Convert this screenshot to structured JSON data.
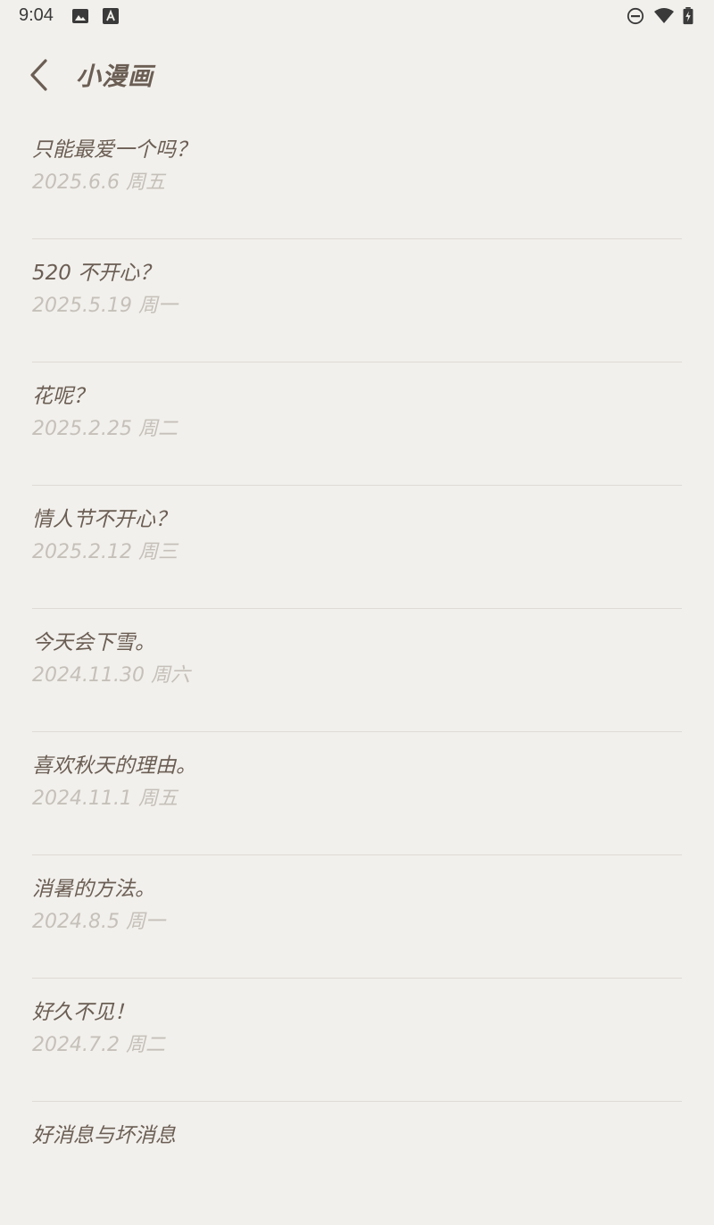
{
  "status_bar": {
    "time": "9:04",
    "icons": [
      "image-icon",
      "font-a-icon",
      "do-not-disturb-icon",
      "wifi-icon",
      "battery-charging-icon"
    ]
  },
  "header": {
    "title": "小漫画",
    "back_icon": "chevron-left-icon"
  },
  "items": [
    {
      "title": "只能最爱一个吗？",
      "date": "2025.6.6 周五"
    },
    {
      "title": "520 不开心？",
      "date": "2025.5.19 周一"
    },
    {
      "title": "花呢？",
      "date": "2025.2.25 周二"
    },
    {
      "title": "情人节不开心？",
      "date": "2025.2.12 周三"
    },
    {
      "title": "今天会下雪。",
      "date": "2024.11.30 周六"
    },
    {
      "title": "喜欢秋天的理由。",
      "date": "2024.11.1 周五"
    },
    {
      "title": "消暑的方法。",
      "date": "2024.8.5 周一"
    },
    {
      "title": "好久不见！",
      "date": "2024.7.2 周二"
    },
    {
      "title": "好消息与坏消息",
      "date": ""
    }
  ]
}
